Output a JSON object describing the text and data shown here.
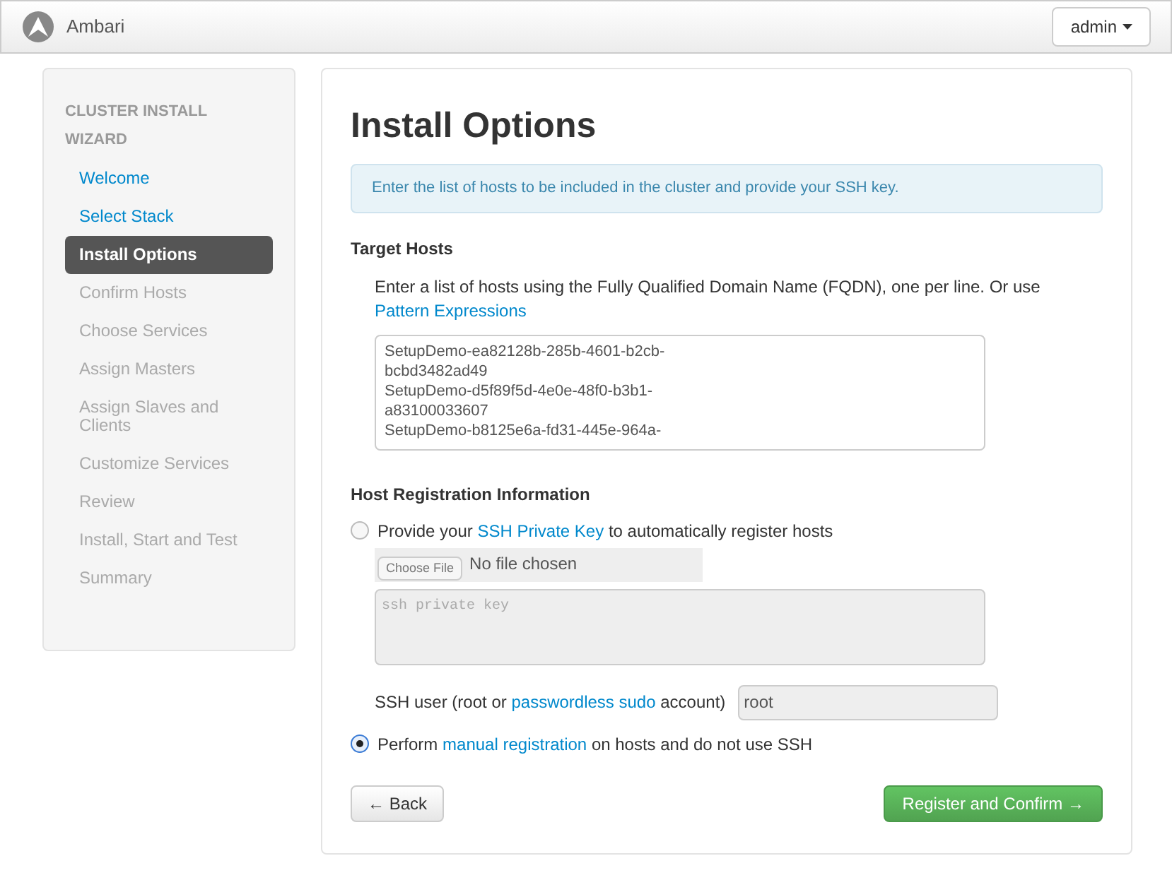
{
  "header": {
    "brand": "Ambari",
    "user_menu": "admin"
  },
  "sidebar": {
    "title": "CLUSTER INSTALL WIZARD",
    "items": [
      {
        "label": "Welcome",
        "selected": false,
        "disabled": false
      },
      {
        "label": "Select Stack",
        "selected": false,
        "disabled": false
      },
      {
        "label": "Install Options",
        "selected": true,
        "disabled": false
      },
      {
        "label": "Confirm Hosts",
        "selected": false,
        "disabled": true
      },
      {
        "label": "Choose Services",
        "selected": false,
        "disabled": true
      },
      {
        "label": "Assign Masters",
        "selected": false,
        "disabled": true
      },
      {
        "label": "Assign Slaves and Clients",
        "selected": false,
        "disabled": true
      },
      {
        "label": "Customize Services",
        "selected": false,
        "disabled": true
      },
      {
        "label": "Review",
        "selected": false,
        "disabled": true
      },
      {
        "label": "Install, Start and Test",
        "selected": false,
        "disabled": true
      },
      {
        "label": "Summary",
        "selected": false,
        "disabled": true
      }
    ]
  },
  "main": {
    "title": "Install Options",
    "info": "Enter the list of hosts to be included in the cluster and provide your SSH key.",
    "target_hosts": {
      "heading": "Target Hosts",
      "help": "Enter a list of hosts using the Fully Qualified Domain Name (FQDN), one per line. Or use",
      "help_link": "Pattern Expressions",
      "value": "SetupDemo-ea82128b-285b-4601-b2cb-\nbcbd3482ad49\nSetupDemo-d5f89f5d-4e0e-48f0-b3b1-\na83100033607\nSetupDemo-b8125e6a-fd31-445e-964a-"
    },
    "registration": {
      "heading": "Host Registration Information",
      "options": [
        {
          "before": "Provide your",
          "link": "SSH Private Key",
          "after": "to automatically register hosts",
          "selected": false
        },
        {
          "before": "Perform",
          "link": "manual registration",
          "after": "on hosts and do not use SSH",
          "selected": true
        }
      ],
      "file_button": "Choose File",
      "file_status": "No file chosen",
      "key_placeholder": "ssh private key",
      "ssh_user": {
        "before": "SSH user (root or",
        "link": "passwordless sudo",
        "after": "account)",
        "value": "root"
      }
    },
    "buttons": {
      "back": "← Back",
      "next": "Register and Confirm →"
    }
  }
}
